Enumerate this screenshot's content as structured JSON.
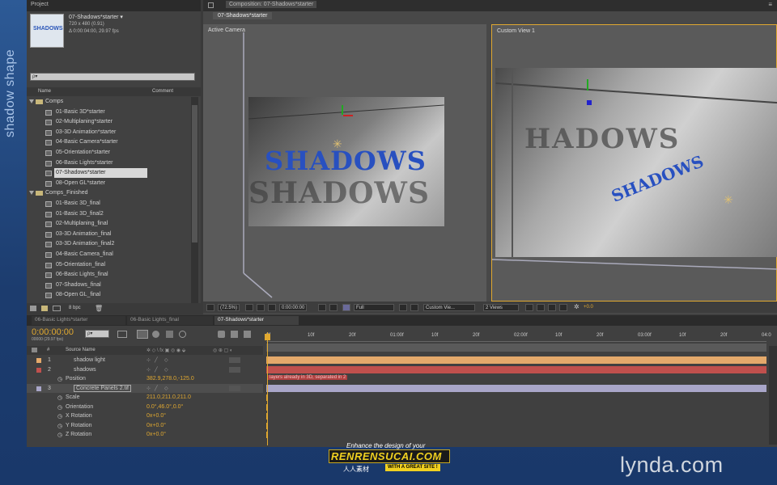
{
  "side_title": "shadow shape",
  "project": {
    "tab_label": "Project",
    "comp_name": "07-Shadows*starter ▾",
    "comp_size": "720 x 480 (0.91)",
    "comp_duration": "Δ 0:00:04:00, 29.97 fps",
    "thumbnail_text": "SHADOWS",
    "search_placeholder": "ρ▾",
    "col_name": "Name",
    "col_comment": "Comment",
    "folders": [
      {
        "name": "Comps",
        "items": [
          "01-Basic 3D*starter",
          "02-Multiplaning*starter",
          "03-3D Animation*starter",
          "04-Basic Camera*starter",
          "05-Orientation*starter",
          "06-Basic Lights*starter",
          "07-Shadows*starter",
          "08-Open GL*starter"
        ]
      },
      {
        "name": "Comps_Finished",
        "items": [
          "01-Basic 3D_final",
          "01-Basic 3D_final2",
          "02-Multiplaning_final",
          "03-3D Animation_final",
          "03-3D Animation_final2",
          "04-Basic Camera_final",
          "05-Orientation_final",
          "06-Basic Lights_final",
          "07-Shadows_final",
          "08-Open GL_final"
        ]
      }
    ],
    "selected_item": "07-Shadows*starter",
    "bpc": "8 bpc"
  },
  "composition": {
    "panel_tab": "Composition: 07-Shadows*starter",
    "subtab": "07-Shadows*starter",
    "view_left_label": "Active Camera",
    "view_right_label": "Custom View 1",
    "scene_text_left": "SHADOWS",
    "scene_text_right_shadow": "HADOWS",
    "scene_text_right_small": "SHADOWS",
    "zoom": "(72.5%)",
    "timecode": "0:00:00:00",
    "resolution": "Full",
    "view_select": "Custom Vie...",
    "views_count": "2 Views",
    "exposure": "+0.0",
    "colors": {
      "text_blue": "#2850c0",
      "accent": "#e0a830"
    }
  },
  "timeline": {
    "tabs": [
      "06-Basic Lights*starter",
      "06-Basic Lights_final",
      "07-Shadows*starter"
    ],
    "active_tab": "07-Shadows*starter",
    "current_time": "0:00:00:00",
    "fps_info": "00000 (29.97 fps)",
    "search_placeholder": "ρ▾",
    "col_source_name": "Source Name",
    "col_hash": "#",
    "ruler": [
      "0f",
      "10f",
      "20f",
      "01:00f",
      "10f",
      "20f",
      "02:00f",
      "10f",
      "20f",
      "03:00f",
      "10f",
      "20f",
      "04:0"
    ],
    "layers": [
      {
        "num": "1",
        "name": "shadow light",
        "color": "#e4a96b"
      },
      {
        "num": "2",
        "name": "shadows",
        "color": "#c0504d"
      },
      {
        "num": "3",
        "name": "Concrete Panels 2.tif",
        "color": "#a9a6c9"
      }
    ],
    "position_label": "Position",
    "position_value": "382.9,278.0,-125.0",
    "tooltip": "layers already in 3D, separated in 2",
    "transform_props": [
      {
        "name": "Scale",
        "value": "211.0,211.0,211.0"
      },
      {
        "name": "Orientation",
        "value": "0.0°,46.0°,0.0°"
      },
      {
        "name": "X Rotation",
        "value": "0x+0.0°"
      },
      {
        "name": "Y Rotation",
        "value": "0x+0.0°"
      },
      {
        "name": "Z Rotation",
        "value": "0x+0.0°"
      }
    ]
  },
  "watermark": {
    "line1": "Enhance the design of your",
    "brand": "RENRENSUCAI.COM",
    "cn": "人人素材",
    "tagline": "WITH A GREAT SITE !",
    "lynda": "lynda.com"
  }
}
